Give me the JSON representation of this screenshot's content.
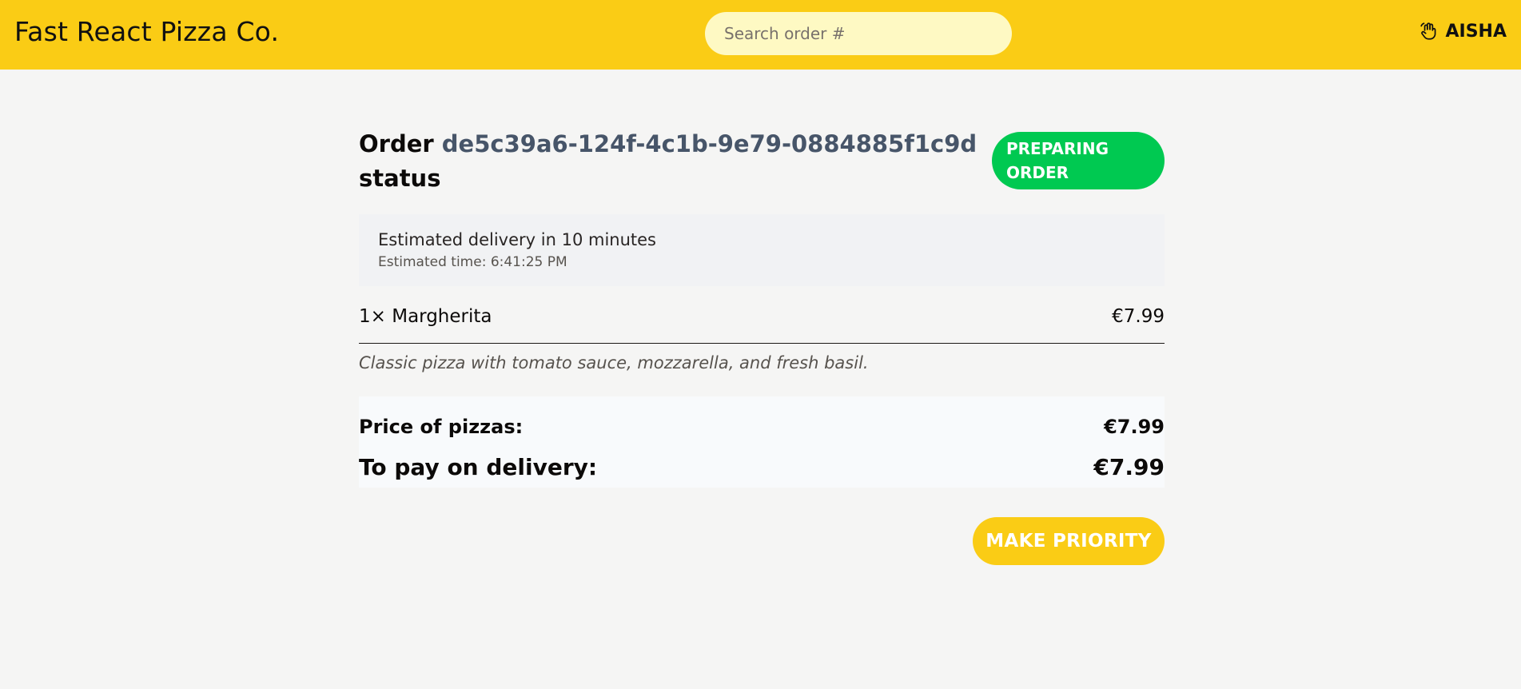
{
  "header": {
    "logo": "Fast React Pizza Co.",
    "search_placeholder": "Search order #",
    "username": "AISHA",
    "user_icon": "waving-hand-icon"
  },
  "order": {
    "title_prefix": "Order",
    "id": "de5c39a6-124f-4c1b-9e79-0884885f1c9d",
    "title_suffix": "status",
    "status": "PREPARING ORDER",
    "status_color": "#00c951",
    "delivery_estimate": "Estimated delivery in 10 minutes",
    "delivery_time": "Estimated time: 6:41:25 PM",
    "items": [
      {
        "quantity_label": "1×",
        "name": "Margherita",
        "price": "€7.99",
        "description": "Classic pizza with tomato sauce, mozzarella, and fresh basil."
      }
    ],
    "totals": {
      "pizzas_label": "Price of pizzas:",
      "pizzas_value": "€7.99",
      "pay_label": "To pay on delivery:",
      "pay_value": "€7.99"
    },
    "priority_button": "MAKE PRIORITY"
  },
  "colors": {
    "brand": "#facc15",
    "background": "#f5f5f4"
  }
}
